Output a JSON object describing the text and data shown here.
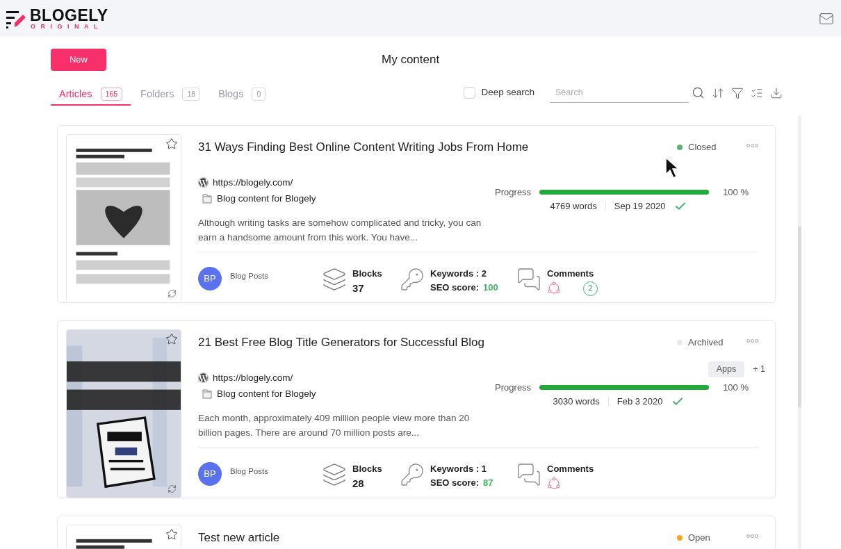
{
  "logo": {
    "word": "BLOGELY",
    "sub": "ORIGINAL"
  },
  "new_button": "New",
  "page_title": "My content",
  "tabs": [
    {
      "label": "Articles",
      "count": "165",
      "selected": true
    },
    {
      "label": "Folders",
      "count": "18",
      "selected": false
    },
    {
      "label": "Blogs",
      "count": "0",
      "selected": false
    }
  ],
  "deep_search": {
    "label": "Deep search",
    "checked": false
  },
  "search": {
    "placeholder": "Search"
  },
  "articles": [
    {
      "title": "31 Ways Finding Best Online Content Writing Jobs From Home",
      "status": {
        "label": "Closed",
        "color": "#5fb17a"
      },
      "site": "https://blogely.com/",
      "blog": "Blog content for Blogely",
      "excerpt": "Although writing tasks are somehow complicated and tricky, you can earn a handsome amount from this work. You have...",
      "progress": {
        "label": "Progress",
        "level": 1,
        "reading": "100 %"
      },
      "words": "4769 words",
      "date": "Sep 19 2020",
      "category_initials": "BP",
      "category": "Blog Posts",
      "blocks_label": "Blocks",
      "blocks": "37",
      "keywords_label": "Keywords :",
      "keywords": "2",
      "seo_label": "SEO score:",
      "seo": "100",
      "comments_label": "Comments",
      "comment_count": "2"
    },
    {
      "title": "21 Best Free Blog Title Generators for Successful Blog",
      "status": {
        "label": "Archived",
        "color": "#e6e8f0"
      },
      "site": "https://blogely.com/",
      "blog": "Blog content for Blogely",
      "tags": [
        "Apps"
      ],
      "tags_more": "+ 1",
      "excerpt": "Each month, approximately 409 million people view more than 20 billion pages. There are around 70 million posts are...",
      "progress": {
        "label": "Progress",
        "level": 1,
        "reading": "100 %"
      },
      "words": "3030 words",
      "date": "Feb 3 2020",
      "category_initials": "BP",
      "category": "Blog Posts",
      "blocks_label": "Blocks",
      "blocks": "28",
      "keywords_label": "Keywords :",
      "keywords": "1",
      "seo_label": "SEO score:",
      "seo": "87",
      "comments_label": "Comments"
    },
    {
      "title": "Test new article",
      "status": {
        "label": "Open",
        "color": "#f5a623"
      }
    }
  ]
}
